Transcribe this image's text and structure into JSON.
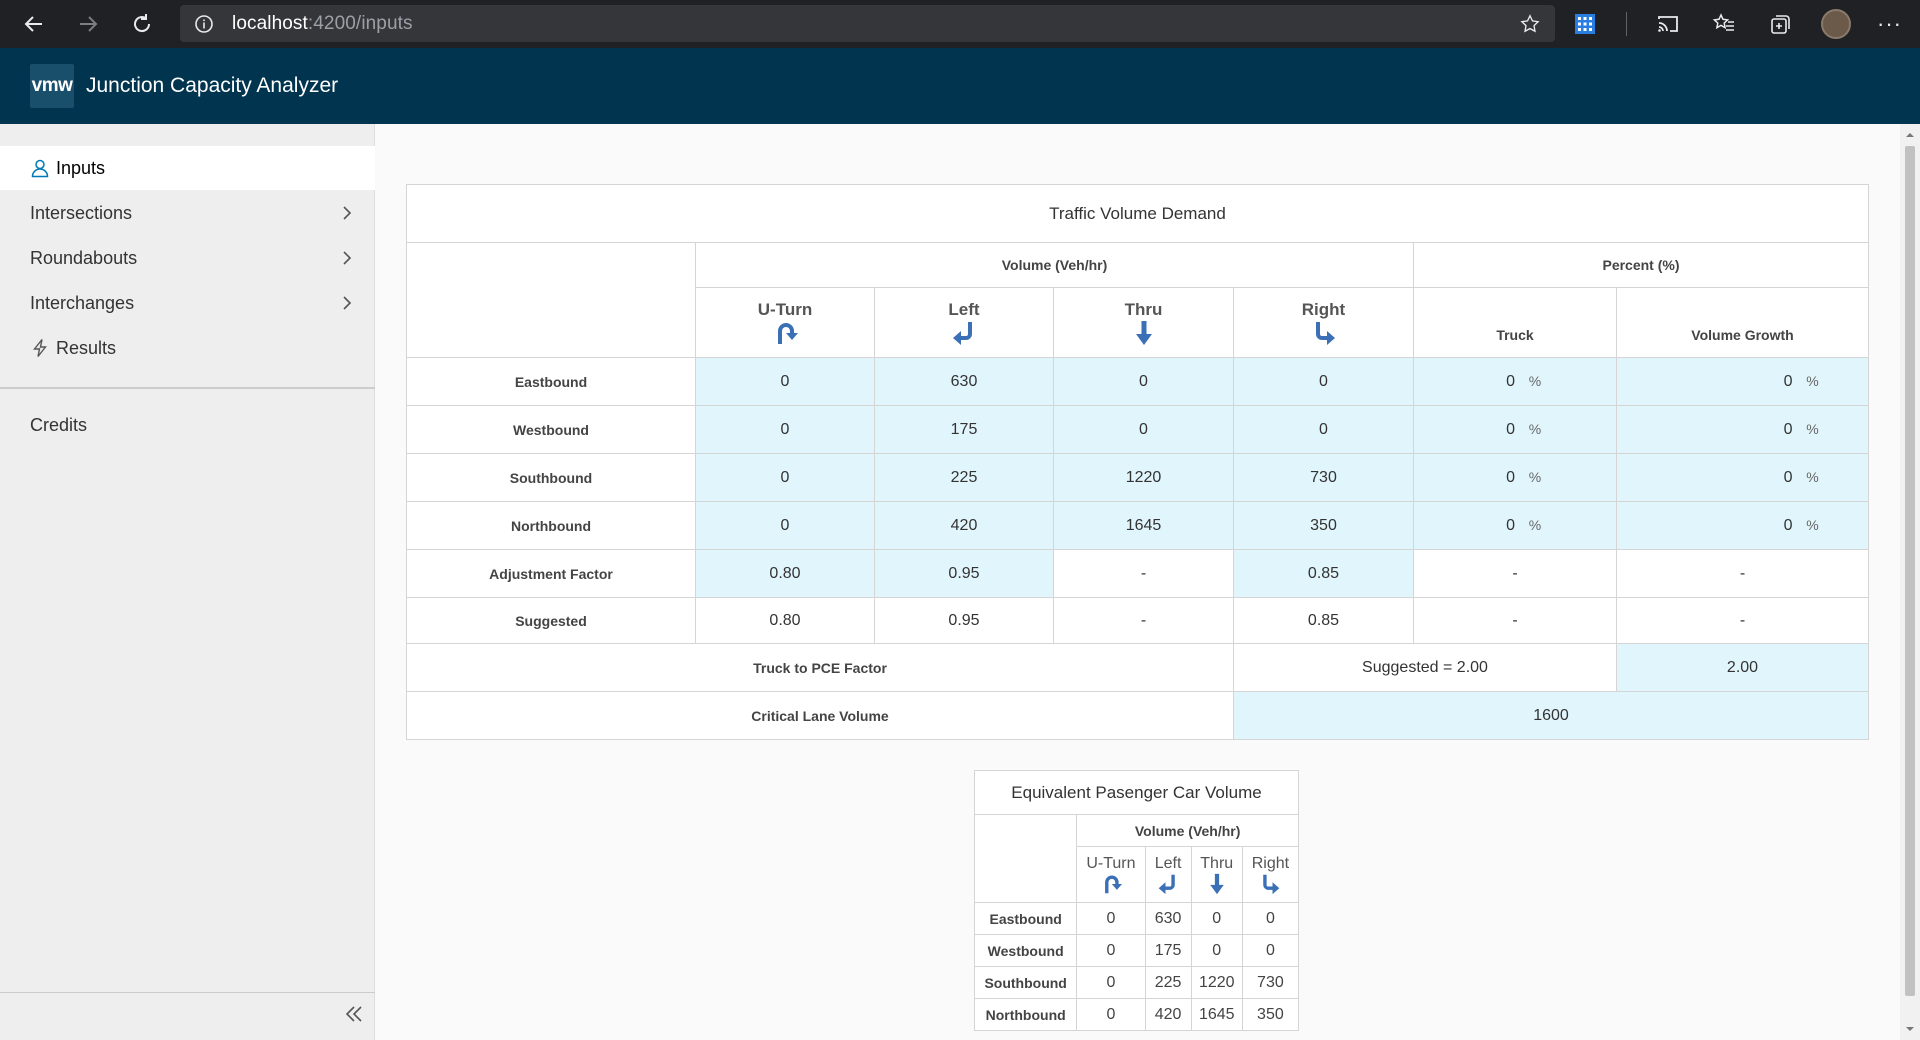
{
  "browser": {
    "url_host": "localhost",
    "url_path": ":4200/inputs"
  },
  "app": {
    "logo_text": "vmw",
    "title": "Junction Capacity Analyzer"
  },
  "sidebar": {
    "items": [
      {
        "label": "Inputs",
        "icon": "user-icon",
        "active": true
      },
      {
        "label": "Intersections",
        "has_chevron": true
      },
      {
        "label": "Roundabouts",
        "has_chevron": true
      },
      {
        "label": "Interchanges",
        "has_chevron": true
      },
      {
        "label": "Results",
        "icon": "lightning-icon"
      }
    ],
    "credits": "Credits"
  },
  "tvd": {
    "title": "Traffic Volume Demand",
    "volume_header": "Volume (Veh/hr)",
    "percent_header": "Percent (%)",
    "directions": [
      "U-Turn",
      "Left",
      "Thru",
      "Right"
    ],
    "truck": "Truck",
    "growth": "Volume Growth",
    "pct_sign": "%",
    "rows": [
      {
        "label": "Eastbound",
        "values": [
          "0",
          "630",
          "0",
          "0"
        ],
        "truck": "0",
        "growth": "0"
      },
      {
        "label": "Westbound",
        "values": [
          "0",
          "175",
          "0",
          "0"
        ],
        "truck": "0",
        "growth": "0"
      },
      {
        "label": "Southbound",
        "values": [
          "0",
          "225",
          "1220",
          "730"
        ],
        "truck": "0",
        "growth": "0"
      },
      {
        "label": "Northbound",
        "values": [
          "0",
          "420",
          "1645",
          "350"
        ],
        "truck": "0",
        "growth": "0"
      }
    ],
    "adjustment": {
      "label": "Adjustment Factor",
      "values": [
        "0.80",
        "0.95",
        "-",
        "0.85"
      ],
      "truck": "-",
      "growth": "-"
    },
    "suggested": {
      "label": "Suggested",
      "values": [
        "0.80",
        "0.95",
        "-",
        "0.85"
      ],
      "truck": "-",
      "growth": "-"
    },
    "pce": {
      "label": "Truck to PCE Factor",
      "suggested": "Suggested = 2.00",
      "value": "2.00"
    },
    "critical": {
      "label": "Critical Lane Volume",
      "value": "1600"
    }
  },
  "epcv": {
    "title": "Equivalent Pasenger Car Volume",
    "volume_header": "Volume (Veh/hr)",
    "directions": [
      "U-Turn",
      "Left",
      "Thru",
      "Right"
    ],
    "rows": [
      {
        "label": "Eastbound",
        "values": [
          "0",
          "630",
          "0",
          "0"
        ]
      },
      {
        "label": "Westbound",
        "values": [
          "0",
          "175",
          "0",
          "0"
        ]
      },
      {
        "label": "Southbound",
        "values": [
          "0",
          "225",
          "1220",
          "730"
        ]
      },
      {
        "label": "Northbound",
        "values": [
          "0",
          "420",
          "1645",
          "350"
        ]
      }
    ]
  },
  "colors": {
    "header": "#00344f",
    "input_blue": "#e1f5fc",
    "arrow_blue": "#3b6fb6"
  }
}
